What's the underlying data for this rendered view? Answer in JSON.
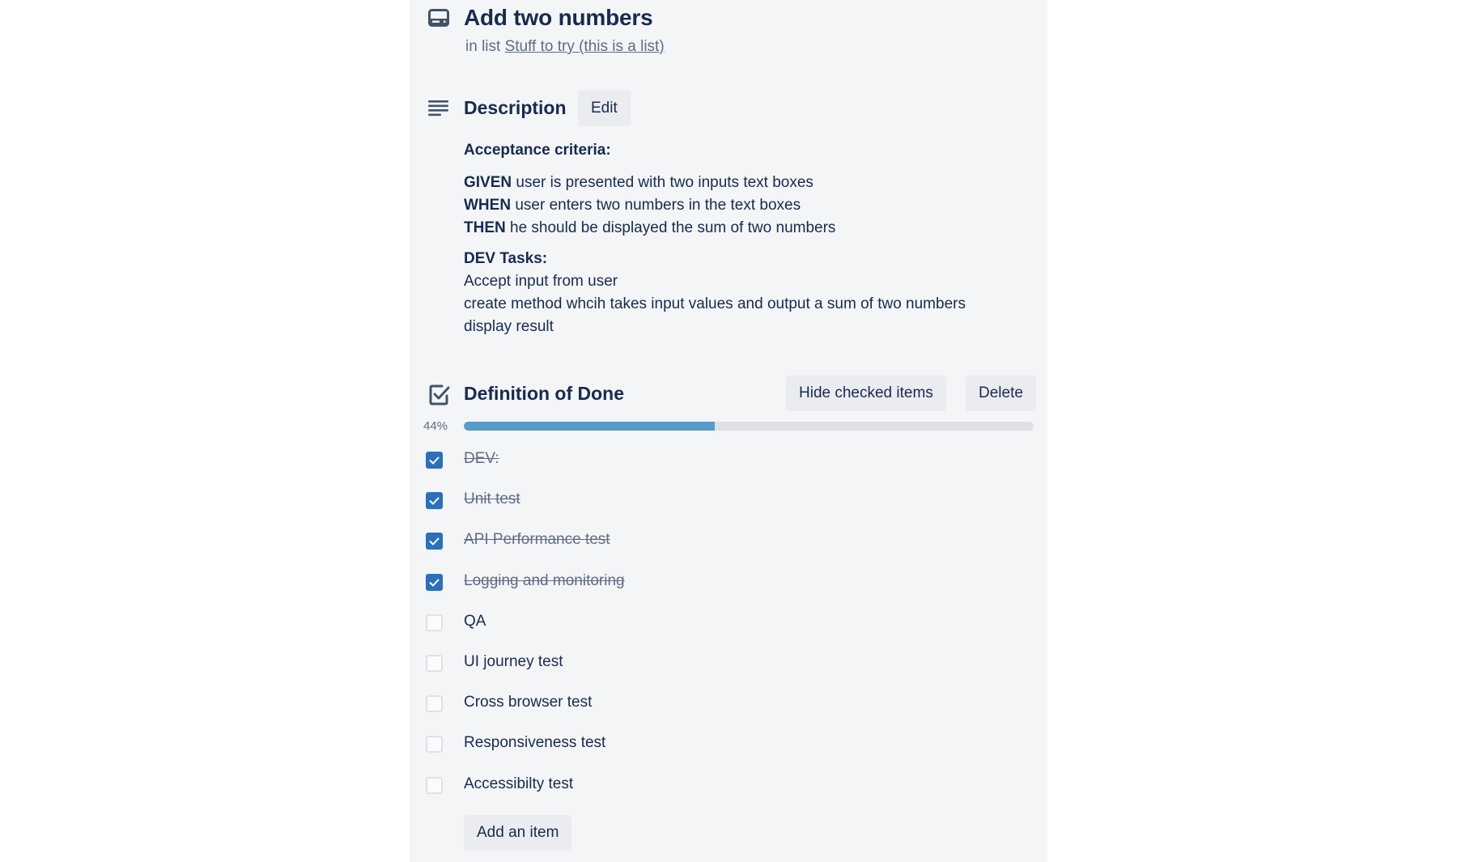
{
  "card": {
    "title": "Add two numbers",
    "list_prefix": "in list",
    "list_name": "Stuff to try (this is a list)",
    "header_icon": "card-icon"
  },
  "description": {
    "heading": "Description",
    "icon": "description-icon",
    "edit_label": "Edit",
    "acceptance_heading": "Acceptance criteria:",
    "criteria": [
      {
        "keyword": "GIVEN",
        "text": " user is presented with two inputs text boxes"
      },
      {
        "keyword": "WHEN",
        "text": " user enters two numbers in the text boxes"
      },
      {
        "keyword": "THEN",
        "text": " he should be displayed the sum of two numbers"
      }
    ],
    "dev_tasks_heading": "DEV Tasks:",
    "dev_tasks": [
      "Accept input from user",
      "create method whcih takes input values and output a sum of two numbers",
      "display result"
    ]
  },
  "checklist": {
    "heading": "Definition of Done",
    "icon": "checklist-icon",
    "hide_checked_label": "Hide checked items",
    "delete_label": "Delete",
    "progress_label": "44%",
    "progress_percent": 44,
    "items": [
      {
        "label": "DEV:",
        "checked": true
      },
      {
        "label": "Unit test",
        "checked": true
      },
      {
        "label": "API Performance test",
        "checked": true
      },
      {
        "label": "Logging and monitoring",
        "checked": true
      },
      {
        "label": "QA",
        "checked": false
      },
      {
        "label": "UI journey test",
        "checked": false
      },
      {
        "label": "Cross browser test",
        "checked": false
      },
      {
        "label": "Responsiveness test",
        "checked": false
      },
      {
        "label": "Accessibilty test",
        "checked": false
      }
    ],
    "add_item_label": "Add an item"
  },
  "colors": {
    "panel_bg": "#f4f5f7",
    "text": "#172b4d",
    "muted": "#5e6c84",
    "check_on": "#2d6fb9",
    "progress_fill": "#5a9ac9",
    "progress_track": "#dfe1e6",
    "button_bg": "#ebecf0"
  }
}
